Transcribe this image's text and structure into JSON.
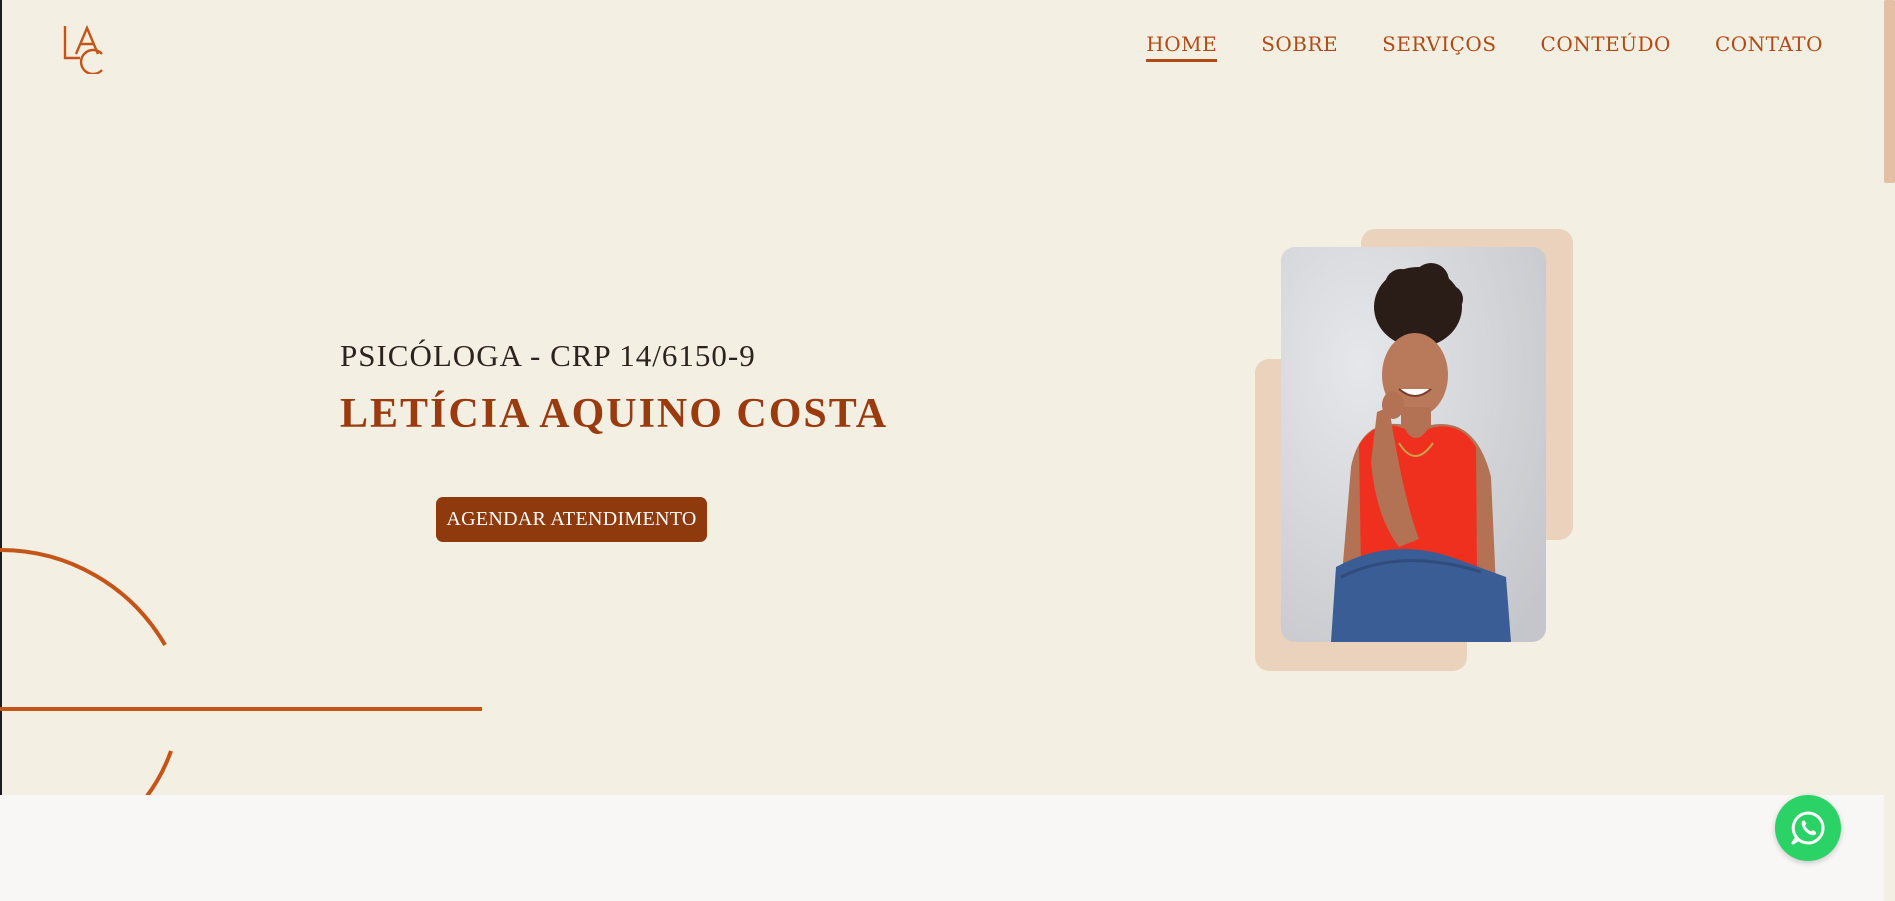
{
  "logo": {
    "icon": "lac-monogram-icon",
    "letters": "LAC",
    "color": "#c55418"
  },
  "nav": {
    "items": [
      {
        "label": "HOME",
        "active": true
      },
      {
        "label": "SOBRE",
        "active": false
      },
      {
        "label": "SERVIÇOS",
        "active": false
      },
      {
        "label": "CONTEÚDO",
        "active": false
      },
      {
        "label": "CONTATO",
        "active": false
      }
    ],
    "color": "#b14a15"
  },
  "hero": {
    "subtitle": "PSICÓLOGA - CRP 14/6150-9",
    "name": "LETÍCIA AQUINO COSTA",
    "cta_label": "AGENDAR ATENDIMENTO",
    "cta_color": "#8e3a0c"
  },
  "photo": {
    "icon": "portrait-photo"
  },
  "whatsapp": {
    "icon": "whatsapp-icon",
    "color": "#2bd366"
  },
  "colors": {
    "background": "#f3f0e3",
    "accent": "#c55418",
    "blob": "#ead2bd"
  }
}
